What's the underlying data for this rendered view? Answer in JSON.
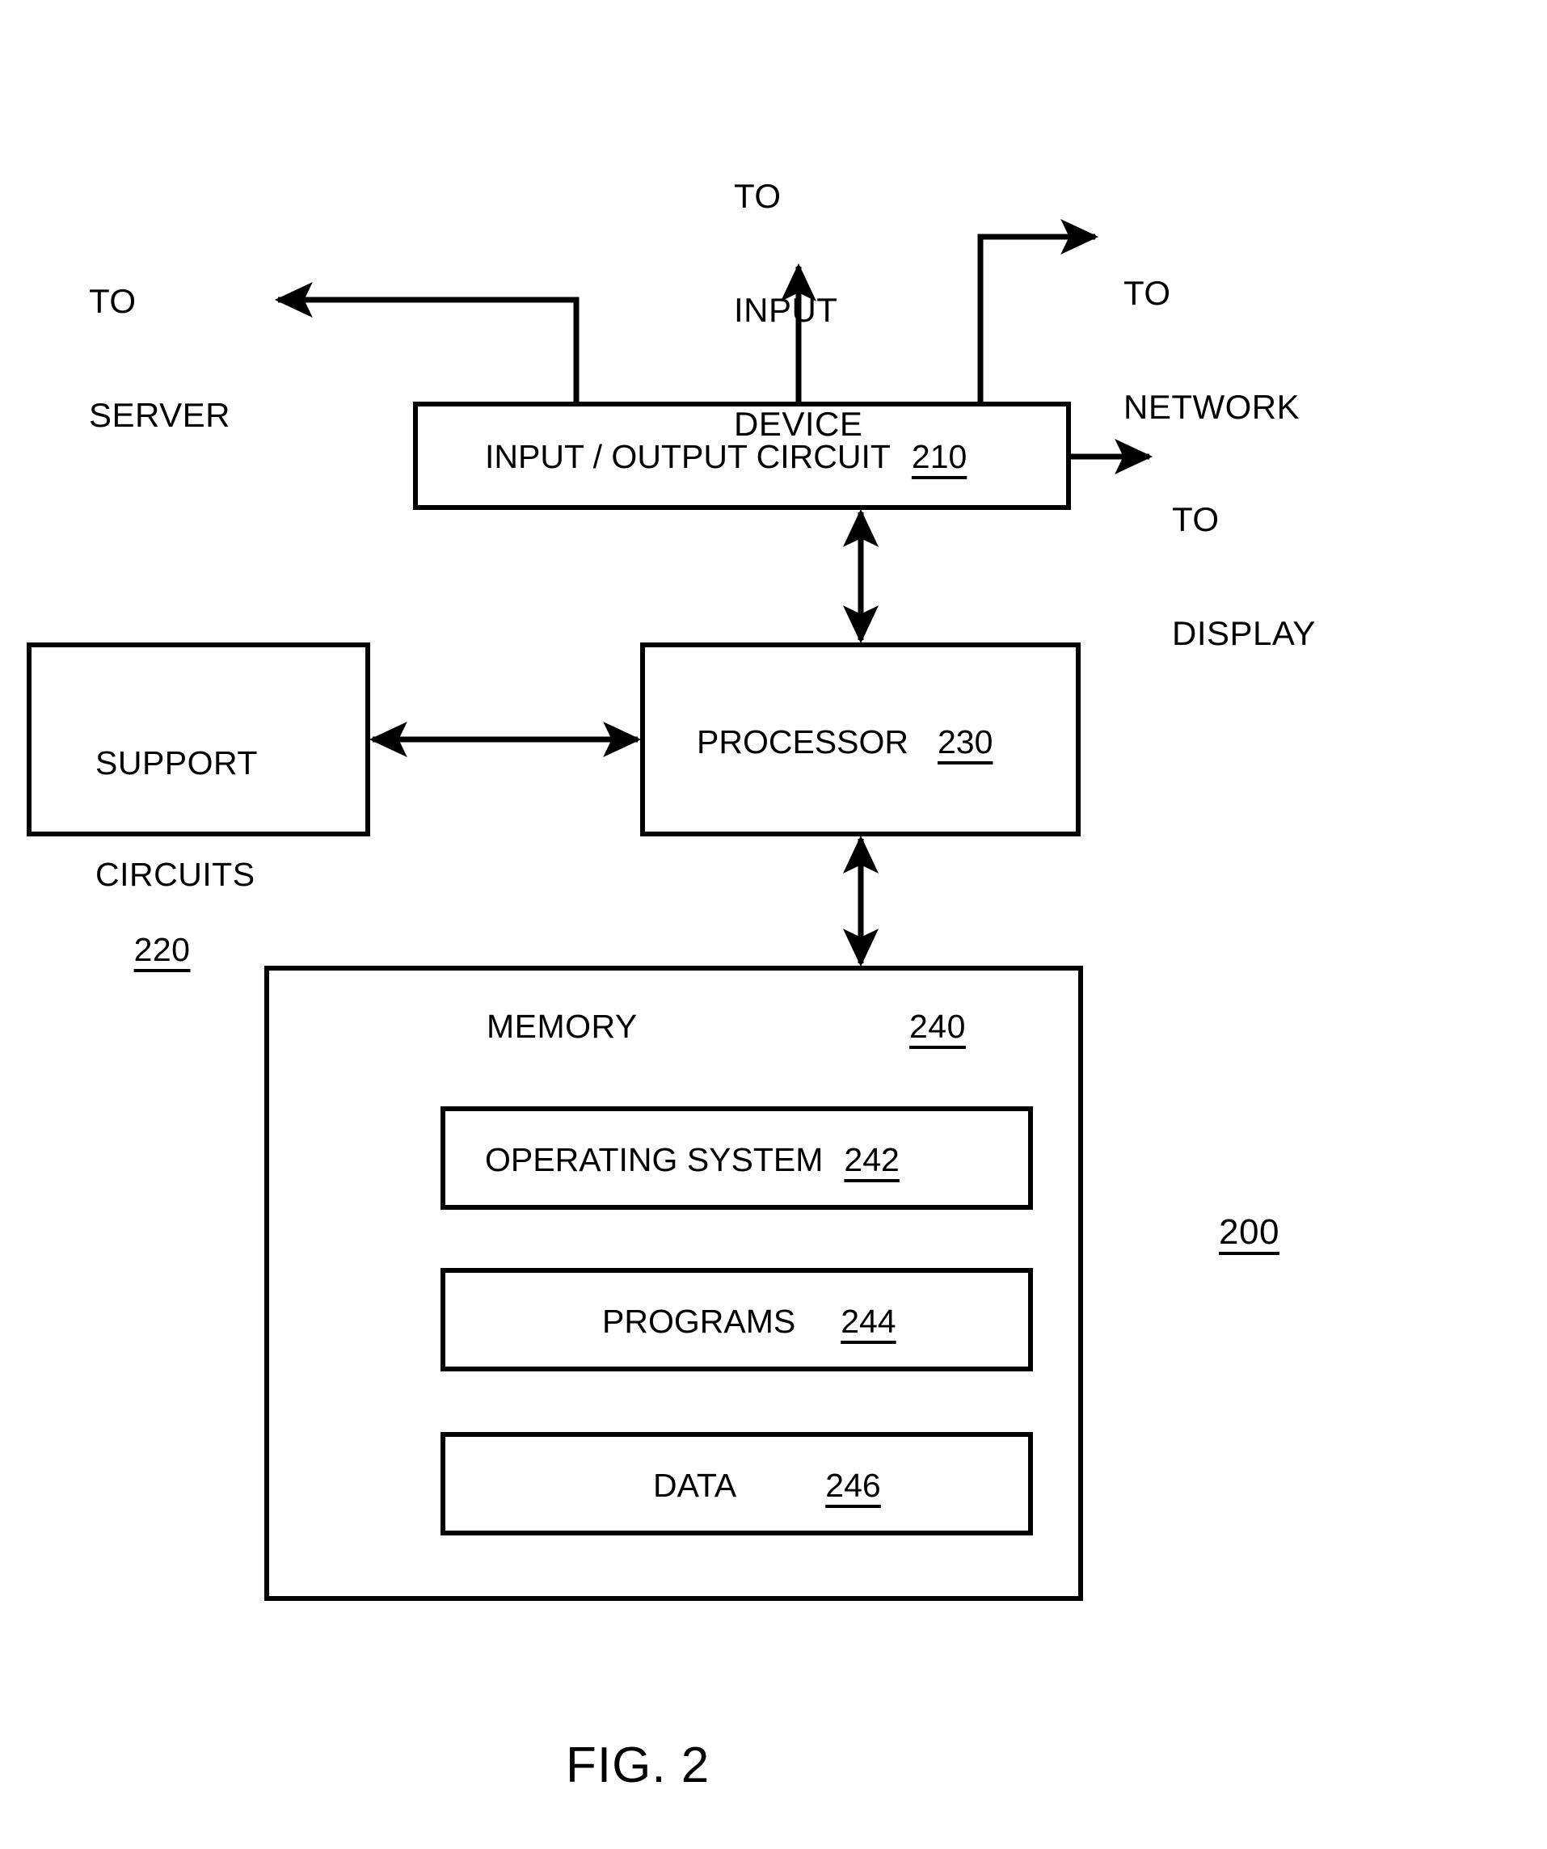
{
  "figure": {
    "caption": "FIG. 2",
    "reference_number": "200"
  },
  "callouts": [
    {
      "id": "to-server",
      "lines": [
        "TO",
        "SERVER"
      ]
    },
    {
      "id": "to-input-device",
      "lines": [
        "TO",
        "INPUT",
        "DEVICE"
      ]
    },
    {
      "id": "to-network",
      "lines": [
        "TO",
        "NETWORK"
      ]
    },
    {
      "id": "to-display",
      "lines": [
        "TO",
        "DISPLAY"
      ]
    }
  ],
  "blocks": {
    "io_circuit": {
      "label": "INPUT / OUTPUT CIRCUIT",
      "ref": "210"
    },
    "support_circuits": {
      "label_line1": "SUPPORT",
      "label_line2": "CIRCUITS",
      "ref": "220"
    },
    "processor": {
      "label": "PROCESSOR",
      "ref": "230"
    },
    "memory": {
      "label": "MEMORY",
      "ref": "240"
    },
    "operating_system": {
      "label": "OPERATING SYSTEM",
      "ref": "242"
    },
    "programs": {
      "label": "PROGRAMS",
      "ref": "244"
    },
    "data": {
      "label": "DATA",
      "ref": "246"
    }
  },
  "connections": [
    {
      "id": "io-to-server",
      "from": "io_circuit",
      "to": "to-server",
      "arrow": "single"
    },
    {
      "id": "io-to-input-device",
      "from": "io_circuit",
      "to": "to-input-device",
      "arrow": "single"
    },
    {
      "id": "io-to-network",
      "from": "io_circuit",
      "to": "to-network",
      "arrow": "single"
    },
    {
      "id": "io-to-display",
      "from": "io_circuit",
      "to": "to-display",
      "arrow": "single"
    },
    {
      "id": "io-processor",
      "from": "io_circuit",
      "to": "processor",
      "arrow": "double"
    },
    {
      "id": "support-processor",
      "from": "support_circuits",
      "to": "processor",
      "arrow": "double"
    },
    {
      "id": "processor-memory",
      "from": "processor",
      "to": "memory",
      "arrow": "double"
    }
  ],
  "colors": {
    "stroke": "#000000",
    "background": "#ffffff"
  }
}
